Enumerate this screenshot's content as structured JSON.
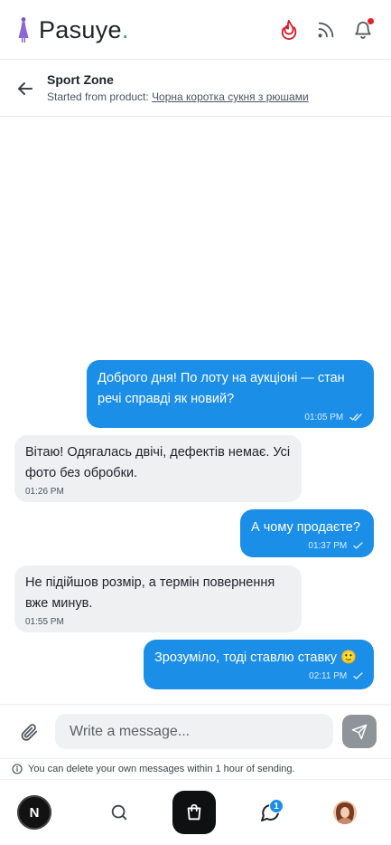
{
  "brand": {
    "name": "Pasuye",
    "dot": ".",
    "logo_icon": "woman-silhouette-icon"
  },
  "header_icons": [
    "flame-icon",
    "rss-icon",
    "bell-icon"
  ],
  "chat": {
    "title": "Sport Zone",
    "subtitle_prefix": "Started from product:",
    "product_link": "Чорна коротка сукня з рюшами"
  },
  "messages": [
    {
      "direction": "out",
      "text": "Доброго дня! По лоту на аукціоні — стан речі справді як новий?",
      "time": "01:05 PM",
      "status": "read"
    },
    {
      "direction": "in",
      "text": "Вітаю! Одягалась двічі, дефектів немає. Усі фото без обробки.",
      "time": "01:26 PM"
    },
    {
      "direction": "out",
      "text": "А чому продаєте?",
      "time": "01:37 PM",
      "status": "sent"
    },
    {
      "direction": "in",
      "text": "Не підійшов розмір, а термін повернення вже минув.",
      "time": "01:55 PM"
    },
    {
      "direction": "out",
      "text": "Зрозуміло, тоді ставлю ставку 🙂",
      "time": "02:11 PM",
      "status": "sent"
    }
  ],
  "composer": {
    "placeholder": "Write a message...",
    "value": ""
  },
  "hint": "You can delete your own messages within 1 hour of sending.",
  "nav": {
    "avatar_letter": "N",
    "messages_badge": "1"
  },
  "colors": {
    "accent": "#1b8ee8",
    "flame": "#d41c2a",
    "bell_dot": "#e5202a"
  }
}
